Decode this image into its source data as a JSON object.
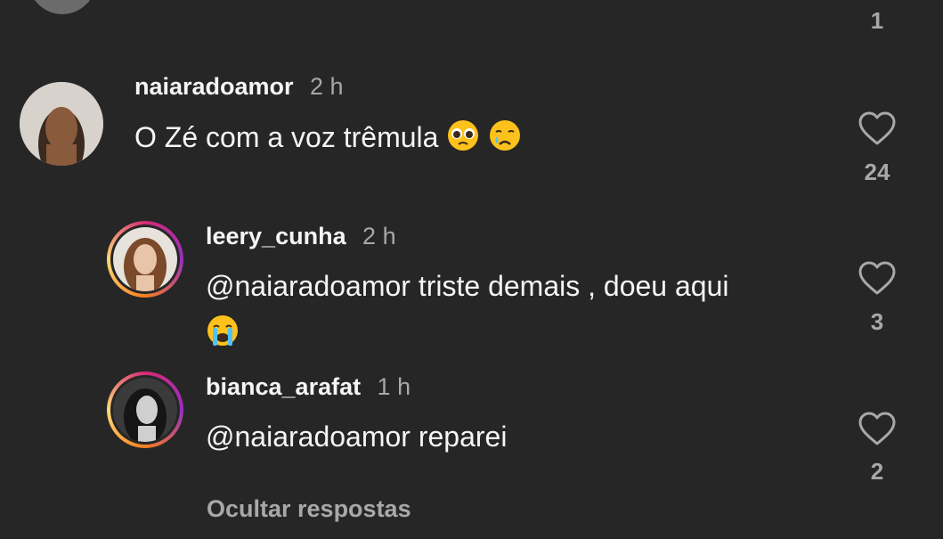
{
  "top": {
    "count": "1"
  },
  "comment": {
    "username": "naiaradoamor",
    "time": "2 h",
    "text": "O Zé com a voz trêmula",
    "likes": "24"
  },
  "replies": [
    {
      "username": "leery_cunha",
      "time": "2 h",
      "mention": "@naiaradoamor",
      "text": " triste demais , doeu aqui",
      "likes": "3"
    },
    {
      "username": "bianca_arafat",
      "time": "1 h",
      "mention": "@naiaradoamor",
      "text": " reparei",
      "likes": "2"
    }
  ],
  "hide_replies_label": "Ocultar respostas",
  "icons": {
    "like": "heart-outline-icon",
    "emoji_pleading": "pleading-face-emoji-icon",
    "emoji_crying": "crying-face-emoji-icon",
    "emoji_sobbing": "loudly-crying-face-emoji-icon"
  }
}
